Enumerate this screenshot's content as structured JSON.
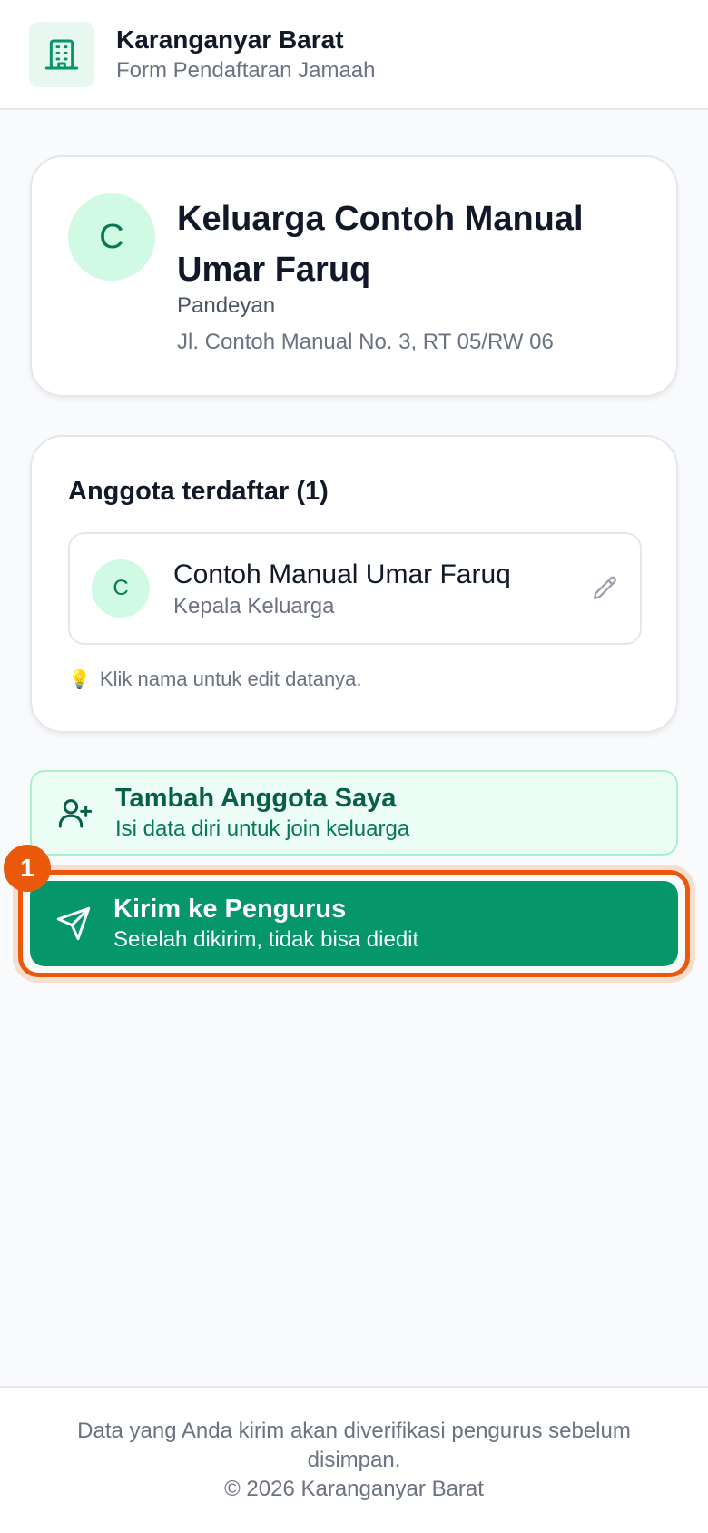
{
  "header": {
    "title": "Karanganyar Barat",
    "subtitle": "Form Pendaftaran Jamaah",
    "icon": "building-icon"
  },
  "family": {
    "initial": "C",
    "name": "Keluarga Contoh Manual Umar Faruq",
    "area": "Pandeyan",
    "address": "Jl. Contoh Manual No. 3, RT 05/RW 06"
  },
  "members": {
    "title": "Anggota terdaftar (1)",
    "items": [
      {
        "initial": "C",
        "name": "Contoh Manual Umar Faruq",
        "role": "Kepala Keluarga"
      }
    ],
    "hint_icon": "💡",
    "hint": "Klik nama untuk edit datanya."
  },
  "actions": {
    "add": {
      "title": "Tambah Anggota Saya",
      "subtitle": "Isi data diri untuk join keluarga",
      "icon": "user-plus-icon"
    },
    "send": {
      "title": "Kirim ke Pengurus",
      "subtitle": "Setelah dikirim, tidak bisa diedit",
      "icon": "send-icon"
    }
  },
  "annotation": {
    "badge": "1"
  },
  "footer": {
    "note": "Data yang Anda kirim akan diverifikasi pengurus sebelum disimpan.",
    "copyright": "© 2026 Karanganyar Barat"
  },
  "colors": {
    "primary": "#059669",
    "accent_light": "#ecfdf5",
    "highlight": "#ea580c"
  }
}
